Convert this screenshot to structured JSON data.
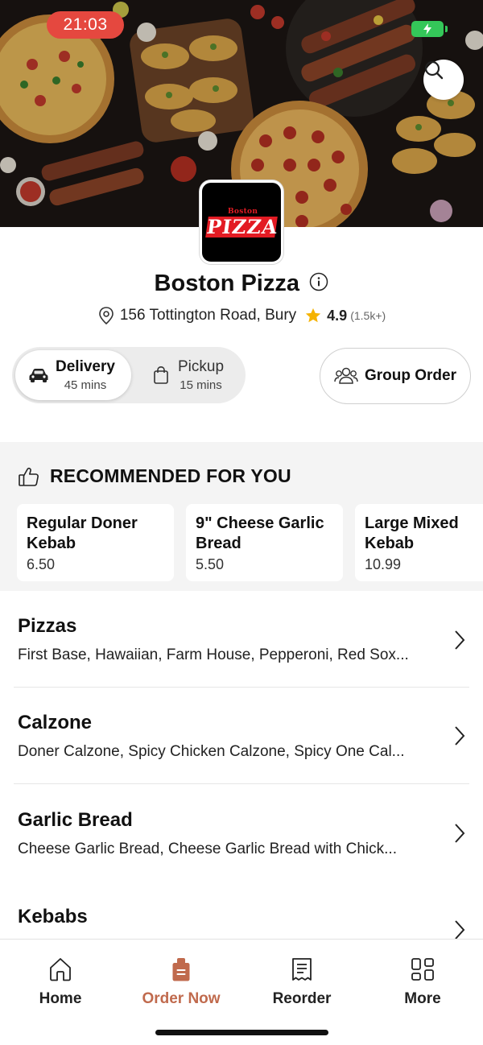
{
  "status_bar": {
    "time": "21:03"
  },
  "restaurant": {
    "name": "Boston Pizza",
    "logo_top_text": "Boston",
    "logo_main_text": "PIZZA",
    "address": "156 Tottington Road, Bury",
    "rating": "4.9",
    "rating_count": "(1.5k+)"
  },
  "order_mode": {
    "delivery": {
      "label": "Delivery",
      "time": "45 mins"
    },
    "pickup": {
      "label": "Pickup",
      "time": "15 mins"
    },
    "selected": "delivery"
  },
  "group_order": {
    "label": "Group Order"
  },
  "recommended": {
    "title": "RECOMMENDED FOR YOU",
    "items": [
      {
        "name": "Regular Doner Kebab",
        "price": "6.50"
      },
      {
        "name": "9\" Cheese Garlic Bread",
        "price": "5.50"
      },
      {
        "name": "Large Mixed Kebab",
        "price": "10.99"
      }
    ]
  },
  "categories": [
    {
      "name": "Pizzas",
      "items": "First Base, Hawaiian, Farm House, Pepperoni, Red Sox..."
    },
    {
      "name": "Calzone",
      "items": "Doner Calzone, Spicy Chicken Calzone, Spicy One Cal..."
    },
    {
      "name": "Garlic Bread",
      "items": "Cheese Garlic Bread, Cheese Garlic Bread with Chick..."
    },
    {
      "name": "Kebabs",
      "items": ""
    }
  ],
  "tab_bar": {
    "items": [
      {
        "label": "Home",
        "icon": "home-icon"
      },
      {
        "label": "Order Now",
        "icon": "order-bag-icon"
      },
      {
        "label": "Reorder",
        "icon": "receipt-icon"
      },
      {
        "label": "More",
        "icon": "grid-icon"
      }
    ],
    "active_index": 1
  },
  "colors": {
    "accent": "#c06a4d",
    "time_pill": "#e5483f",
    "battery": "#34c759",
    "star": "#f5b301",
    "logo_red": "#e31b23"
  }
}
